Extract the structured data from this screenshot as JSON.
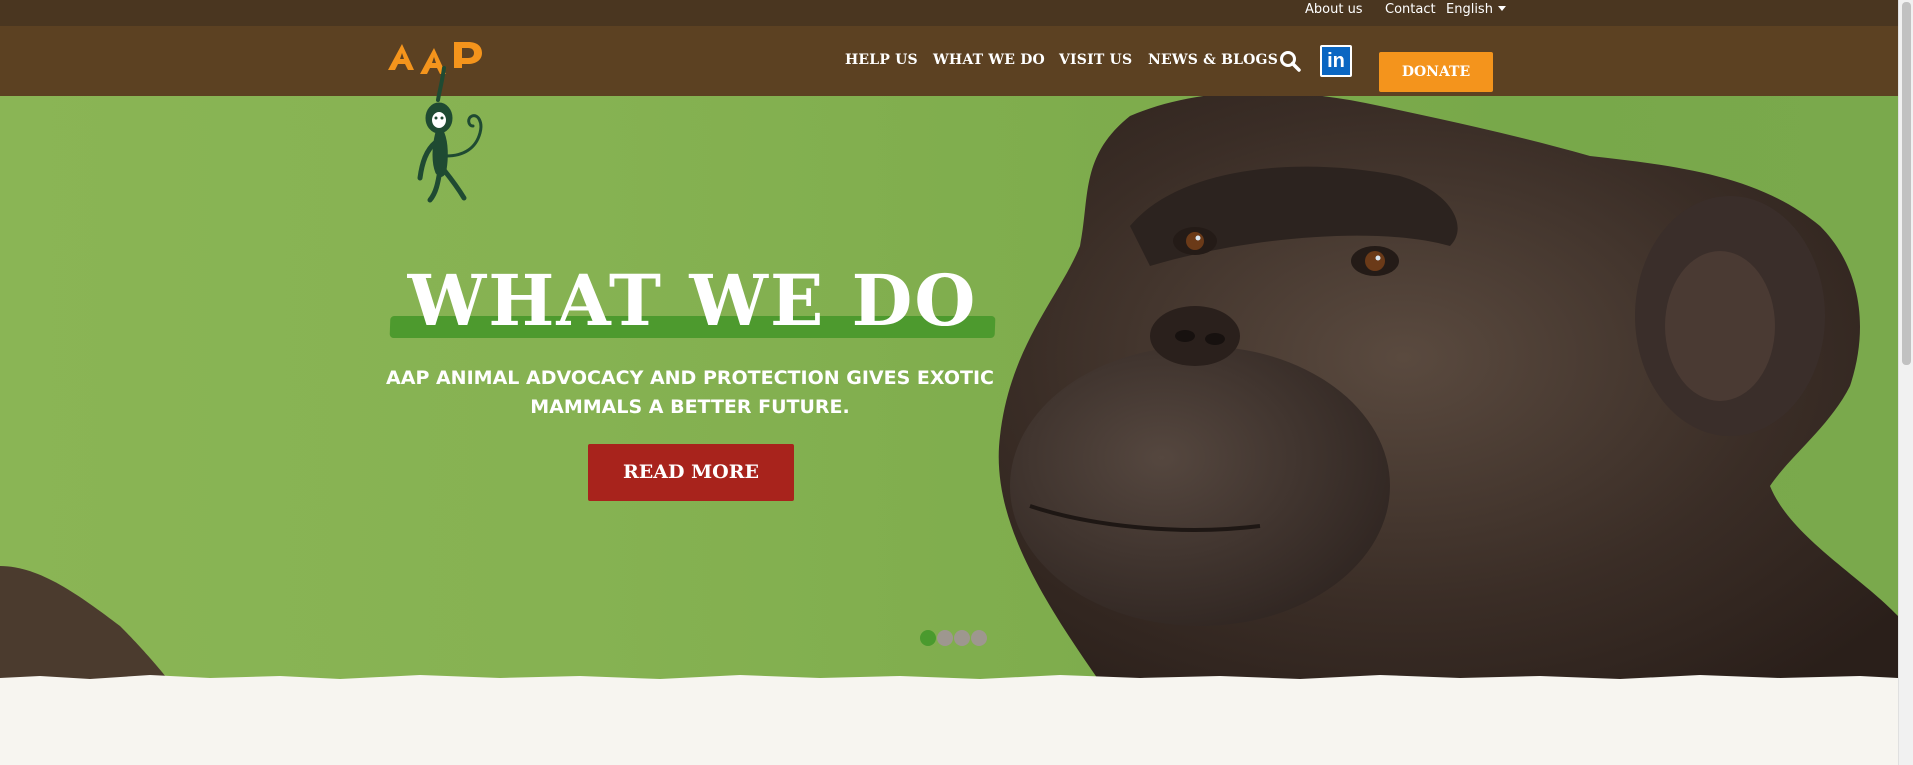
{
  "topbar": {
    "about_label": "About us",
    "contact_label": "Contact",
    "language_label": "English"
  },
  "nav": {
    "items": [
      {
        "label": "HELP US"
      },
      {
        "label": "WHAT WE DO"
      },
      {
        "label": "VISIT US"
      },
      {
        "label": "NEWS & BLOGS"
      }
    ],
    "search_icon": "search-icon",
    "linkedin_label": "in",
    "donate_label": "DONATE"
  },
  "logo": {
    "text": "AAP"
  },
  "hero": {
    "title": "WHAT WE DO",
    "subtitle": "AAP ANIMAL ADVOCACY AND PROTECTION GIVES EXOTIC MAMMALS A BETTER FUTURE.",
    "cta_label": "READ MORE",
    "slides_total": 4,
    "active_slide": 1
  },
  "colors": {
    "topbar_bg": "#4a3620",
    "nav_bg": "#5c4122",
    "donate_bg": "#f4941c",
    "hero_green": "#7fad4d",
    "title_stripe": "#4d9a2e",
    "cta_bg": "#a8231c",
    "linkedin_bg": "#0a66c2",
    "logo_orange": "#f4941c",
    "logo_monkey": "#1f4a32"
  }
}
